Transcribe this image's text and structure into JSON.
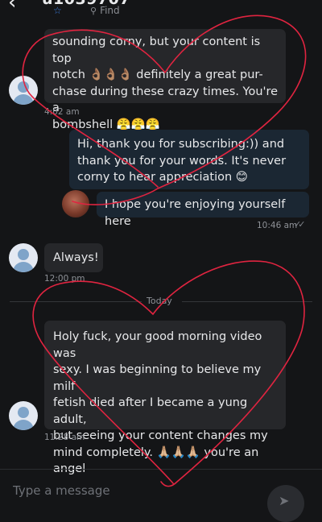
{
  "header": {
    "username": "u1039707",
    "star_icon": "star-icon",
    "find_label": "Find",
    "find_icon": "search-icon"
  },
  "messages": [
    {
      "side": "in",
      "lines": [
        "sounding corny, but your content is top",
        "notch 👌🏽👌🏽👌🏽 definitely a great pur-",
        "chase during these crazy times. You're a",
        "bombshell 😤😤😤"
      ],
      "time": "4:02 am"
    },
    {
      "side": "out",
      "lines": [
        "Hi, thank you for subscribing:)) and",
        "thank you for your words. It's never",
        "corny to hear appreciation 😊"
      ]
    },
    {
      "side": "out",
      "lines": [
        "I hope you're enjoying yourself here"
      ],
      "time": "10:46 am",
      "status_icon": "double-check-icon"
    },
    {
      "side": "in",
      "lines": [
        "Always!"
      ],
      "time": "12:00 pm"
    },
    {
      "side": "in",
      "lines": [
        "Holy fuck, your good morning video was",
        "sexy. I was beginning to believe my milf",
        "fetish died after I became a yung adult,",
        "but seeing your content changes my",
        "mind completely. 🙏🏼🙏🏼🙏🏼 you're an",
        "angel"
      ],
      "time": "11:28 am"
    }
  ],
  "divider": {
    "label": "Today"
  },
  "composer": {
    "placeholder": "Type a message",
    "send_icon": "send-icon"
  },
  "colors": {
    "background": "#141517",
    "incoming_bubble": "#26272a",
    "outgoing_bubble": "#1b2733",
    "accent": "#3b7ddd",
    "drawing": "#e02440"
  }
}
